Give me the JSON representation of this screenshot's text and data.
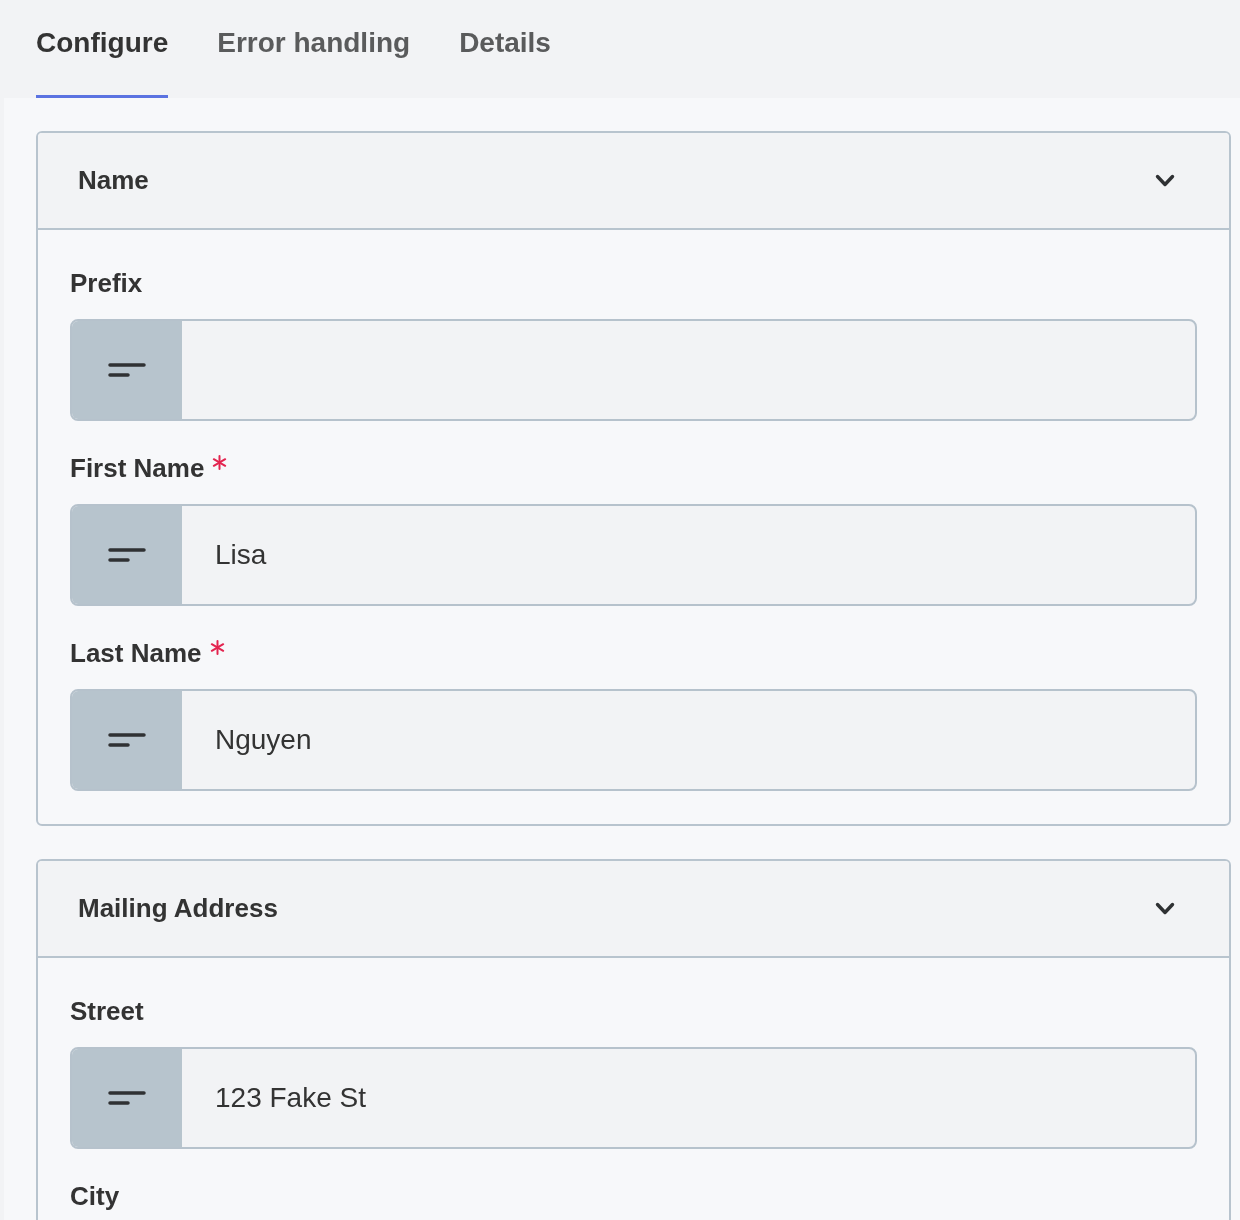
{
  "tabs": [
    {
      "label": "Configure",
      "selected": true
    },
    {
      "label": "Error handling",
      "selected": false
    },
    {
      "label": "Details",
      "selected": false
    }
  ],
  "sections": [
    {
      "title": "Name",
      "fields": [
        {
          "kind": "text",
          "label": "Prefix",
          "required": false
        },
        {
          "kind": "text",
          "label": "First Name",
          "required": true,
          "value": "Lisa"
        },
        {
          "kind": "text",
          "label": "Last Name",
          "required": true,
          "value": "Nguyen"
        }
      ]
    },
    {
      "title": "Mailing Address",
      "fields": [
        {
          "kind": "text",
          "label": "Street",
          "required": false,
          "value": "123 Fake St"
        },
        {
          "kind": "label",
          "label": "City",
          "required": false
        }
      ]
    }
  ]
}
